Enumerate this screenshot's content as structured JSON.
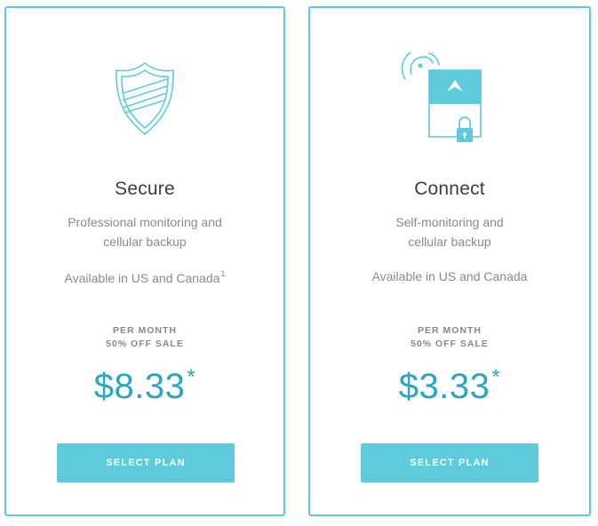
{
  "accent_color": "#5ecbdc",
  "price_color": "#2aa6c0",
  "plans": [
    {
      "icon": "shield-icon",
      "title": "Secure",
      "description_line1": "Professional monitoring and",
      "description_line2": "cellular backup",
      "availability": "Available in US and Canada",
      "availability_footnote": "1",
      "period_line1": "PER MONTH",
      "period_line2": "50% OFF SALE",
      "price": "$8.33",
      "price_footnote": "*",
      "button_label": "SELECT PLAN"
    },
    {
      "icon": "phone-lock-icon",
      "title": "Connect",
      "description_line1": "Self-monitoring and",
      "description_line2": "cellular backup",
      "availability": "Available in US and Canada",
      "period_line1": "PER MONTH",
      "period_line2": "50% OFF SALE",
      "price": "$3.33",
      "price_footnote": "*",
      "button_label": "SELECT PLAN"
    }
  ]
}
